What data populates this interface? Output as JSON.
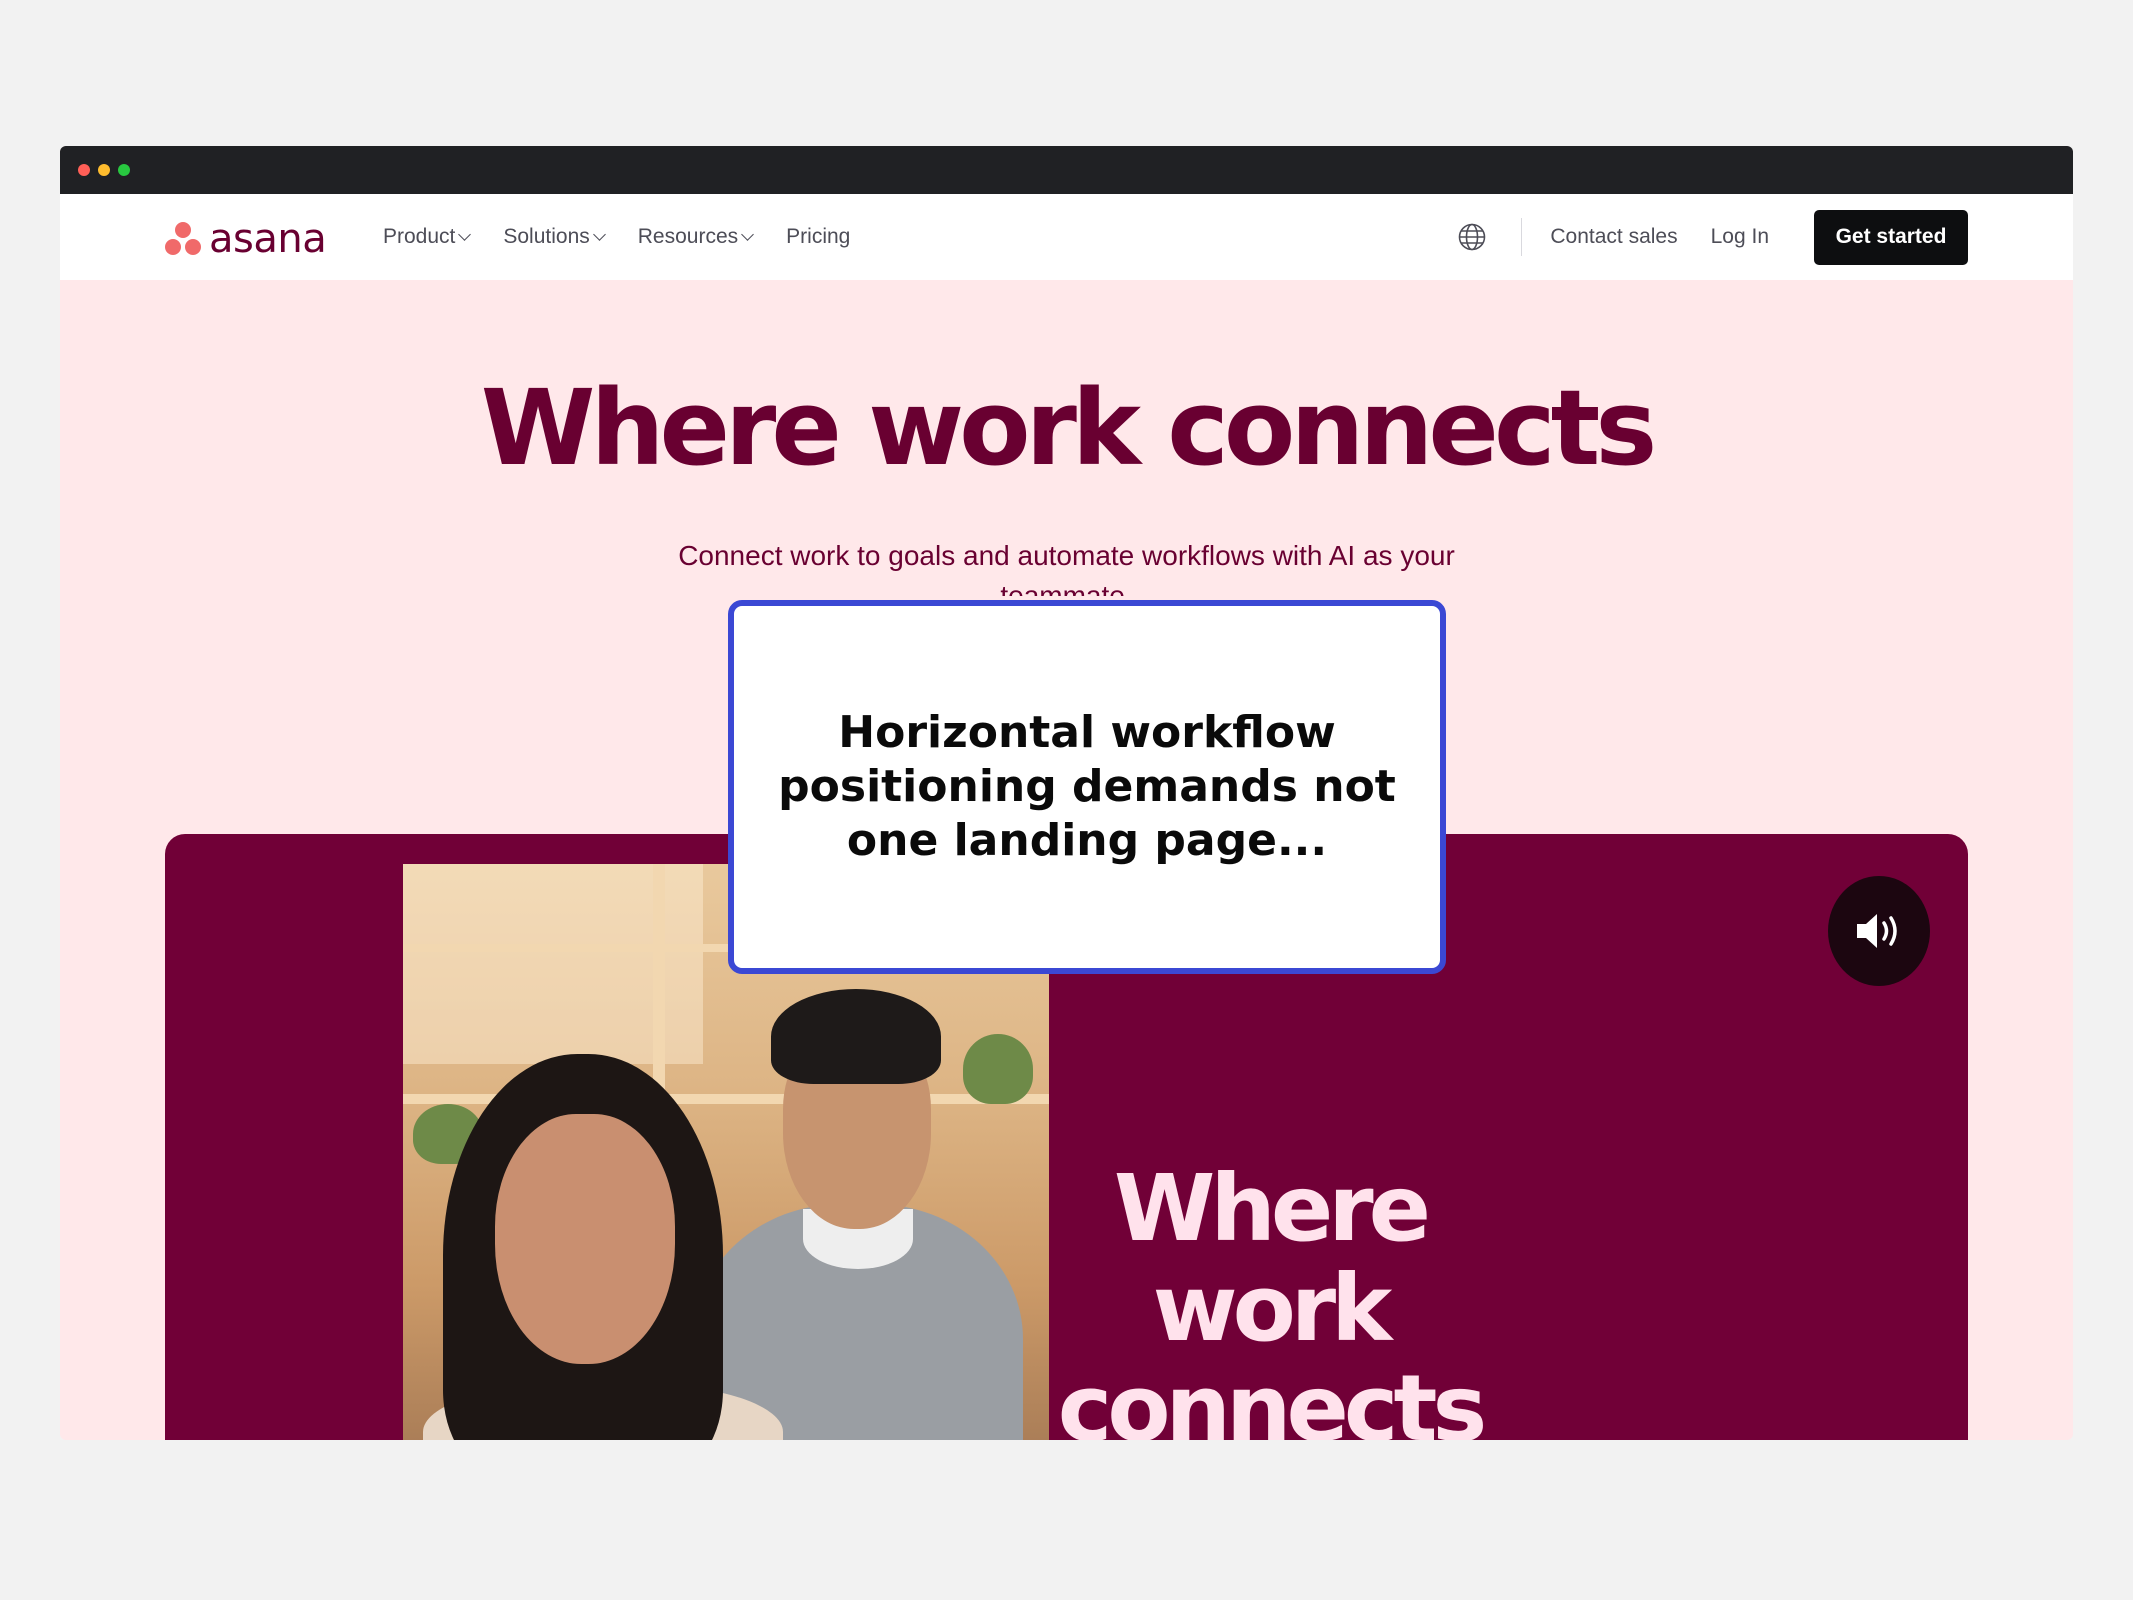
{
  "window": {
    "dots": [
      "#ff5f57",
      "#febc2e",
      "#28c840"
    ]
  },
  "nav": {
    "logo_text": "asana",
    "links": [
      {
        "label": "Product",
        "has_dropdown": true
      },
      {
        "label": "Solutions",
        "has_dropdown": true
      },
      {
        "label": "Resources",
        "has_dropdown": true
      },
      {
        "label": "Pricing",
        "has_dropdown": false
      }
    ],
    "globe_icon": "globe-icon",
    "contact_sales": "Contact sales",
    "log_in": "Log In",
    "get_started": "Get started"
  },
  "hero": {
    "title": "Where work connects",
    "subtitle": "Connect work to goals and automate workflows with AI as your teammate."
  },
  "video": {
    "title": "Where work connects",
    "sound_icon": "speaker-volume-icon"
  },
  "overlay": {
    "text": "Horizontal workflow positioning demands not one landing page..."
  },
  "colors": {
    "brand": "#690031",
    "hero_bg": "#ffe8ea",
    "video_bg": "#710037",
    "logo_coral": "#f06a6a",
    "overlay_border": "#3b48d4"
  }
}
